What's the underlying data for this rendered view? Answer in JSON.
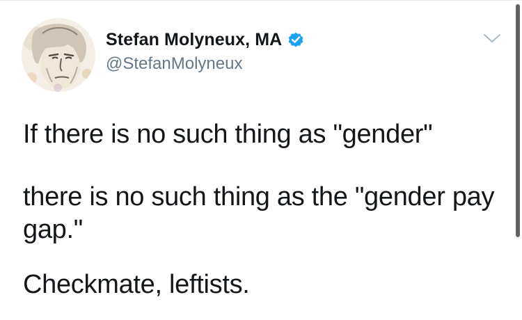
{
  "tweet": {
    "author": {
      "display_name": "Stefan Molyneux, MA",
      "handle": "@StefanMolyneux",
      "verified": true,
      "avatar_icon": "portrait-avatar"
    },
    "menu_icon": "chevron-down-icon",
    "text": {
      "paragraph_1": "If there is no such thing as \"gender\"",
      "paragraph_2": "there is no such thing as the \"gender pay gap.\"",
      "paragraph_3": "Checkmate, leftists."
    }
  },
  "colors": {
    "text_primary": "#14171a",
    "text_secondary": "#657786",
    "verified_blue": "#1da1f2",
    "caret_gray": "#aab8c2"
  }
}
